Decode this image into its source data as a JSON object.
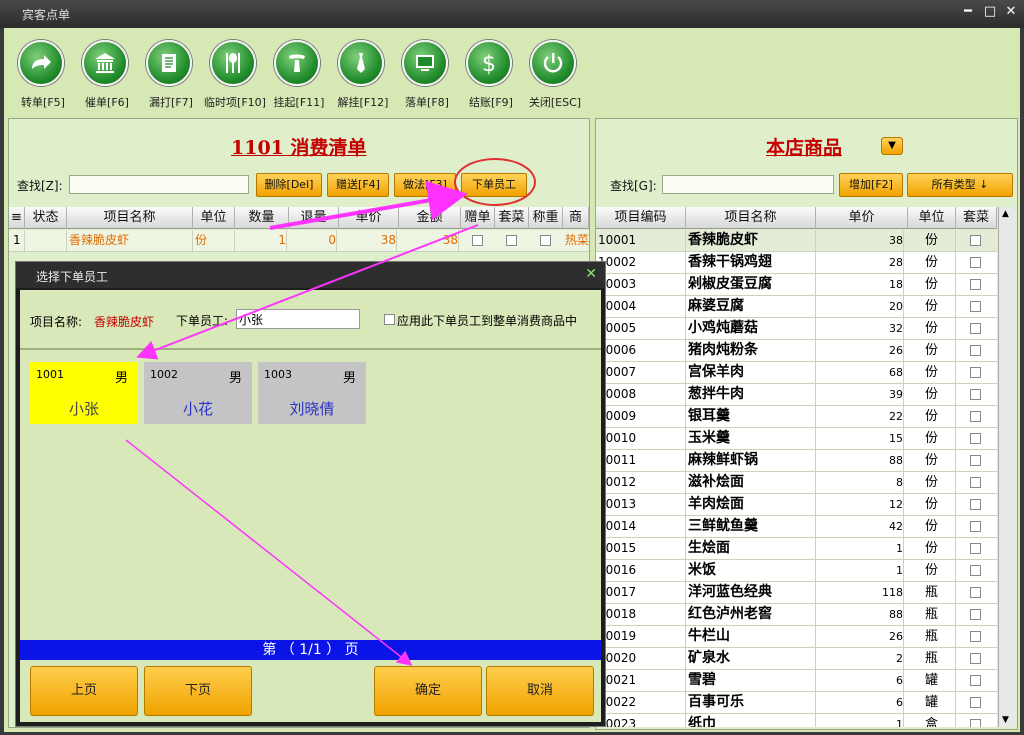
{
  "window": {
    "title": "宾客点单"
  },
  "toolbar": [
    {
      "label": "转单[F5]",
      "icon": "transfer-arrow-icon"
    },
    {
      "label": "催单[F6]",
      "icon": "bank-icon"
    },
    {
      "label": "漏打[F7]",
      "icon": "document-icon"
    },
    {
      "label": "临时项[F10]",
      "icon": "cutlery-icon"
    },
    {
      "label": "挂起[F11]",
      "icon": "waiter-icon"
    },
    {
      "label": "解挂[F12]",
      "icon": "tie-icon"
    },
    {
      "label": "落单[F8]",
      "icon": "screen-icon"
    },
    {
      "label": "结账[F9]",
      "icon": "dollar-icon"
    },
    {
      "label": "关闭[ESC]",
      "icon": "power-icon"
    }
  ],
  "order_panel": {
    "title": "1101  消费清单",
    "search_label": "查找[Z]:",
    "search_value": "",
    "buttons": {
      "delete": "删除[Del]",
      "gift": "赠送[F4]",
      "method": "做法[F3]",
      "staff": "下单员工"
    },
    "columns": [
      "≡",
      "状态",
      "项目名称",
      "单位",
      "数量",
      "退量",
      "单价",
      "金额",
      "赠单",
      "套菜",
      "称重",
      "商"
    ],
    "rows": [
      {
        "no": "1",
        "status": "",
        "name": "香辣脆皮虾",
        "unit": "份",
        "qty": "1",
        "returned": "0",
        "price": "38",
        "amount": "38",
        "extra": "热菜"
      }
    ]
  },
  "product_panel": {
    "title": "本店商品",
    "search_label": "查找[G]:",
    "search_value": "",
    "buttons": {
      "add": "增加[F2]",
      "types": "所有类型 ↓"
    },
    "columns": [
      "项目编码",
      "项目名称",
      "单价",
      "单位",
      "套菜"
    ],
    "rows": [
      {
        "code": "10001",
        "name": "香辣脆皮虾",
        "price": "38",
        "unit": "份"
      },
      {
        "code": "10002",
        "name": "香辣干锅鸡翅",
        "price": "28",
        "unit": "份"
      },
      {
        "code": "10003",
        "name": "剁椒皮蛋豆腐",
        "price": "18",
        "unit": "份"
      },
      {
        "code": "10004",
        "name": "麻婆豆腐",
        "price": "20",
        "unit": "份"
      },
      {
        "code": "10005",
        "name": "小鸡炖蘑菇",
        "price": "32",
        "unit": "份"
      },
      {
        "code": "10006",
        "name": "猪肉炖粉条",
        "price": "26",
        "unit": "份"
      },
      {
        "code": "10007",
        "name": "宫保羊肉",
        "price": "68",
        "unit": "份"
      },
      {
        "code": "10008",
        "name": "葱拌牛肉",
        "price": "39",
        "unit": "份"
      },
      {
        "code": "10009",
        "name": "银耳羹",
        "price": "22",
        "unit": "份"
      },
      {
        "code": "10010",
        "name": "玉米羹",
        "price": "15",
        "unit": "份"
      },
      {
        "code": "10011",
        "name": "麻辣鲜虾锅",
        "price": "88",
        "unit": "份"
      },
      {
        "code": "10012",
        "name": "滋补烩面",
        "price": "8",
        "unit": "份"
      },
      {
        "code": "10013",
        "name": "羊肉烩面",
        "price": "12",
        "unit": "份"
      },
      {
        "code": "10014",
        "name": "三鲜鱿鱼羹",
        "price": "42",
        "unit": "份"
      },
      {
        "code": "10015",
        "name": "生烩面",
        "price": "1",
        "unit": "份"
      },
      {
        "code": "10016",
        "name": "米饭",
        "price": "1",
        "unit": "份"
      },
      {
        "code": "10017",
        "name": "洋河蓝色经典",
        "price": "118",
        "unit": "瓶"
      },
      {
        "code": "10018",
        "name": "红色泸州老窖",
        "price": "88",
        "unit": "瓶"
      },
      {
        "code": "10019",
        "name": "牛栏山",
        "price": "26",
        "unit": "瓶"
      },
      {
        "code": "10020",
        "name": "矿泉水",
        "price": "2",
        "unit": "瓶"
      },
      {
        "code": "10021",
        "name": "雪碧",
        "price": "6",
        "unit": "罐"
      },
      {
        "code": "10022",
        "name": "百事可乐",
        "price": "6",
        "unit": "罐"
      },
      {
        "code": "10023",
        "name": "纸巾",
        "price": "1",
        "unit": "盒"
      }
    ]
  },
  "dialog": {
    "title": "选择下单员工",
    "item_label": "项目名称:",
    "item_value": "香辣脆皮虾",
    "staff_label": "下单员工:",
    "staff_value": "小张",
    "apply_all_label": "应用此下单员工到整单消费商品中",
    "employees": [
      {
        "code": "1001",
        "sex": "男",
        "name": "小张",
        "selected": true
      },
      {
        "code": "1002",
        "sex": "男",
        "name": "小花",
        "selected": false
      },
      {
        "code": "1003",
        "sex": "男",
        "name": "刘晓倩",
        "selected": false
      }
    ],
    "page_text": "第  （  1/1  ）  页",
    "buttons": {
      "prev": "上页",
      "next": "下页",
      "ok": "确定",
      "cancel": "取消"
    }
  },
  "colors": {
    "accent": "#f2a200",
    "title_red": "#c40000",
    "selected": "#ffff00",
    "page_bar": "#0a14e6",
    "annotation": "#ff33ff"
  }
}
